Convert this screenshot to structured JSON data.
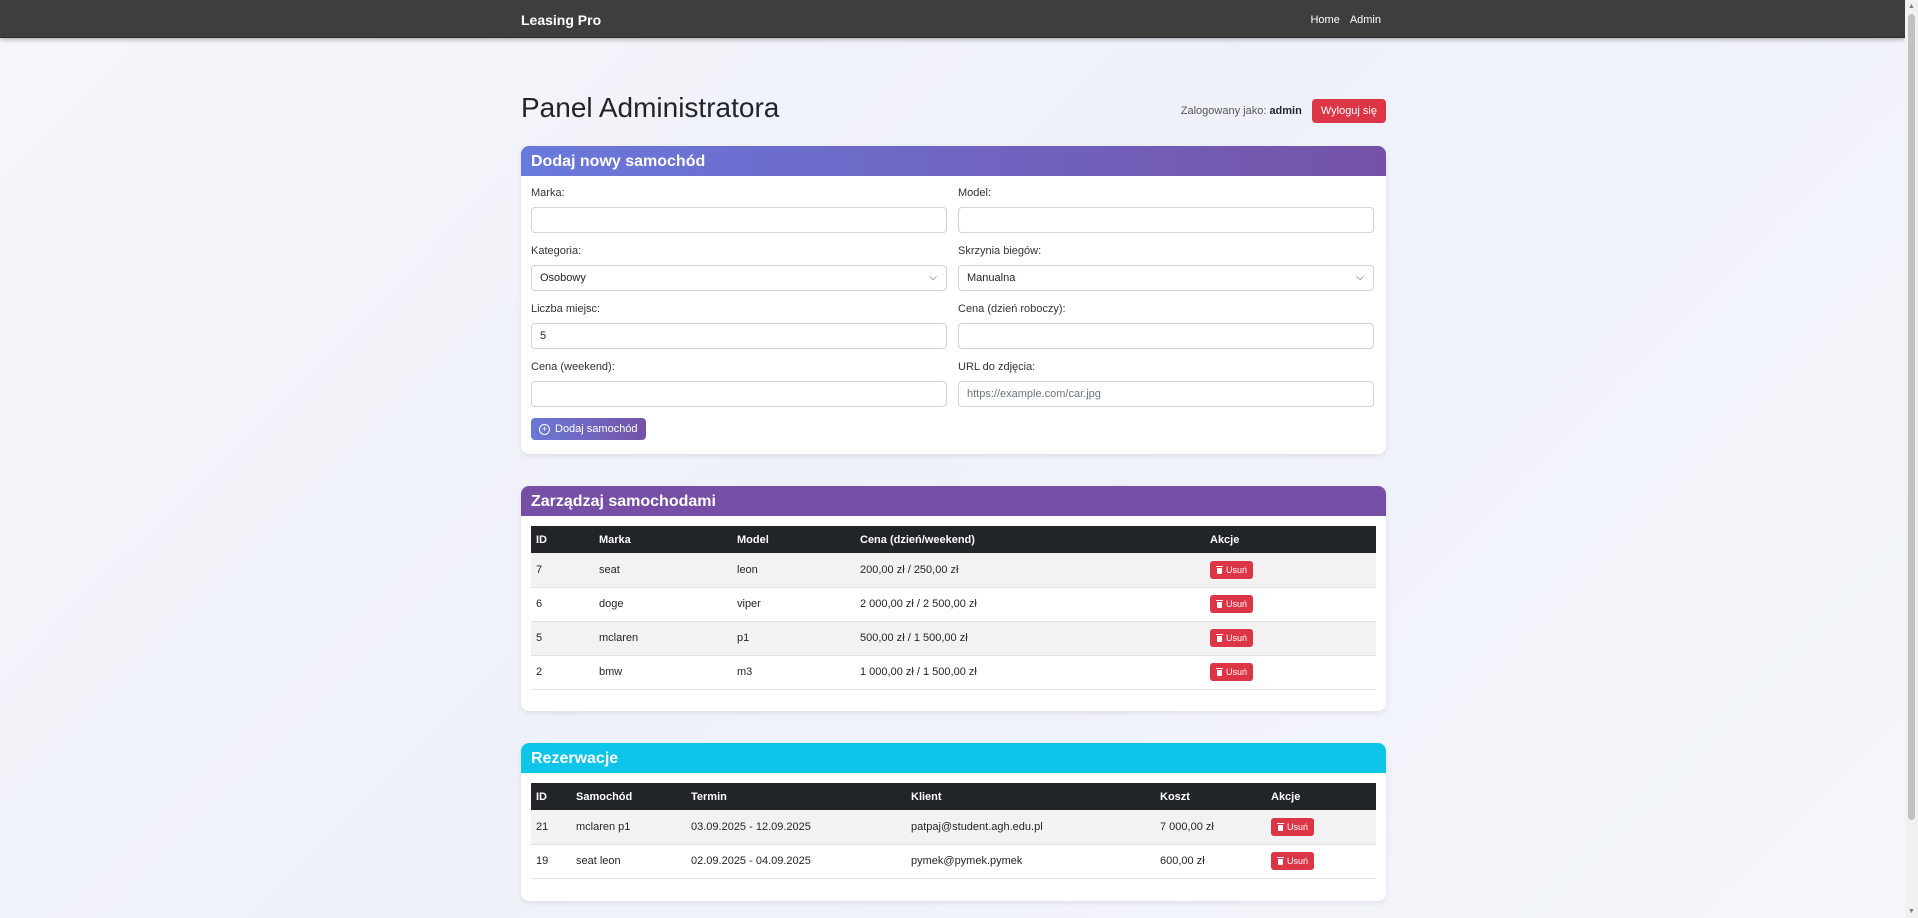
{
  "navbar": {
    "brand": "Leasing Pro",
    "links": [
      "Home",
      "Admin"
    ]
  },
  "page": {
    "title": "Panel Administratora",
    "logged_in_prefix": "Zalogowany jako:",
    "logged_in_user": "admin",
    "logout_label": "Wyloguj się"
  },
  "add_car": {
    "header": "Dodaj nowy samochód",
    "fields": {
      "marka": {
        "label": "Marka:",
        "value": ""
      },
      "model": {
        "label": "Model:",
        "value": ""
      },
      "kategoria": {
        "label": "Kategoria:",
        "value": "Osobowy"
      },
      "skrzynia": {
        "label": "Skrzynia biegów:",
        "value": "Manualna"
      },
      "miejsca": {
        "label": "Liczba miejsc:",
        "value": "5"
      },
      "cena_robocza": {
        "label": "Cena (dzień roboczy):",
        "value": ""
      },
      "cena_weekend": {
        "label": "Cena (weekend):",
        "value": ""
      },
      "url": {
        "label": "URL do zdjęcia:",
        "value": "",
        "placeholder": "https://example.com/car.jpg"
      }
    },
    "submit_label": "Dodaj samochód"
  },
  "manage_cars": {
    "header": "Zarządzaj samochodami",
    "columns": [
      "ID",
      "Marka",
      "Model",
      "Cena (dzień/weekend)",
      "Akcje"
    ],
    "rows": [
      {
        "id": "7",
        "marka": "seat",
        "model": "leon",
        "cena": "200,00 zł / 250,00 zł"
      },
      {
        "id": "6",
        "marka": "doge",
        "model": "viper",
        "cena": "2 000,00 zł / 2 500,00 zł"
      },
      {
        "id": "5",
        "marka": "mclaren",
        "model": "p1",
        "cena": "500,00 zł / 1 500,00 zł"
      },
      {
        "id": "2",
        "marka": "bmw",
        "model": "m3",
        "cena": "1 000,00 zł / 1 500,00 zł"
      }
    ],
    "delete_label": "Usuń"
  },
  "reservations": {
    "header": "Rezerwacje",
    "columns": [
      "ID",
      "Samochód",
      "Termin",
      "Klient",
      "Koszt",
      "Akcje"
    ],
    "rows": [
      {
        "id": "21",
        "samochod": "mclaren p1",
        "termin": "03.09.2025 - 12.09.2025",
        "klient": "patpaj@student.agh.edu.pl",
        "koszt": "7 000,00 zł"
      },
      {
        "id": "19",
        "samochod": "seat leon",
        "termin": "02.09.2025 - 04.09.2025",
        "klient": "pymek@pymek.pymek",
        "koszt": "600,00 zł"
      }
    ],
    "delete_label": "Usuń"
  }
}
